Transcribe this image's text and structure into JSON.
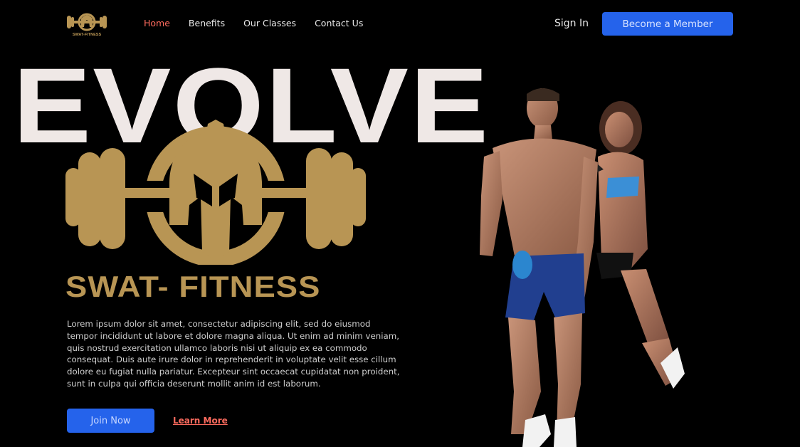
{
  "nav": {
    "logo_text": "SWAT-FITNESS",
    "links": [
      {
        "label": "Home",
        "active": true
      },
      {
        "label": "Benefits",
        "active": false
      },
      {
        "label": "Our Classes",
        "active": false
      },
      {
        "label": "Contact Us",
        "active": false
      }
    ],
    "sign_in": "Sign In",
    "cta": "Become a Member"
  },
  "hero": {
    "headline": "EVOLVE",
    "brand": "SWAT- FITNESS",
    "description": "Lorem ipsum dolor sit amet, consectetur adipiscing elit, sed do eiusmod tempor incididunt ut labore et dolore magna aliqua. Ut enim ad minim veniam, quis nostrud exercitation ullamco laboris nisi ut aliquip ex ea commodo consequat. Duis aute irure dolor in reprehenderit in voluptate velit esse cillum dolore eu fugiat nulla pariatur. Excepteur sint occaecat cupidatat non proident, sunt in culpa qui officia deserunt mollit anim id est laborum.",
    "primary_button": "Join Now",
    "secondary_link": "Learn More",
    "logo_icon": "spartan-helmet-dumbbell-icon",
    "image_subject": "fitness-couple-photo"
  },
  "colors": {
    "background": "#000000",
    "accent_blue": "#2563eb",
    "accent_red": "#ff6b5e",
    "gold": "#b89554",
    "headline": "#efe8e6"
  }
}
